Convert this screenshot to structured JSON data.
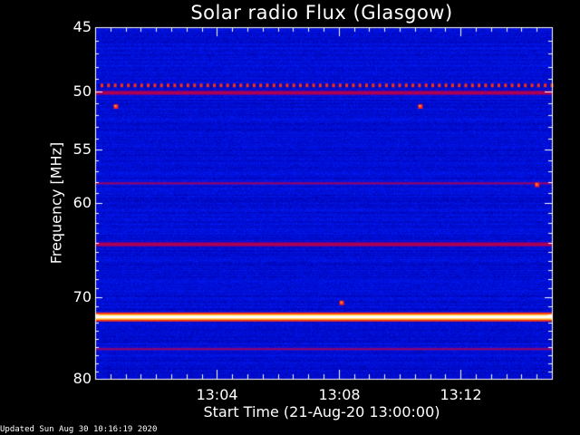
{
  "chart_data": {
    "type": "heatmap",
    "title": "Solar radio Flux (Glasgow)",
    "xlabel": "Start Time (21-Aug-20 13:00:00)",
    "ylabel": "Frequency [MHz]",
    "x_unit": "time",
    "x_range": [
      "13:00:00",
      "13:15:00"
    ],
    "ylim": [
      45,
      80
    ],
    "y_ticks": [
      45,
      50,
      55,
      60,
      70,
      80
    ],
    "x_ticks": [
      "13:04",
      "13:08",
      "13:12"
    ],
    "colormap": [
      "#0000c8",
      "#0033ff",
      "#b00050",
      "#ff2020",
      "#ffd040",
      "#ffffff"
    ],
    "background_level": "low",
    "bright_bands_mhz": [
      {
        "freq": 49.5,
        "level": "medium",
        "pattern": "dotted"
      },
      {
        "freq": 50.1,
        "level": "medium"
      },
      {
        "freq": 58.1,
        "level": "low-medium"
      },
      {
        "freq": 64.2,
        "level": "medium"
      },
      {
        "freq": 72.3,
        "level": "saturated"
      },
      {
        "freq": 76.2,
        "level": "low-medium"
      }
    ],
    "point_features": [
      {
        "time": "13:00:40",
        "freq": 51.2
      },
      {
        "time": "13:10:40",
        "freq": 51.2
      },
      {
        "time": "13:08:05",
        "freq": 70.6
      },
      {
        "time": "13:14:30",
        "freq": 58.2
      }
    ]
  },
  "footer": "Updated Sun Aug 30 10:16:19 2020"
}
